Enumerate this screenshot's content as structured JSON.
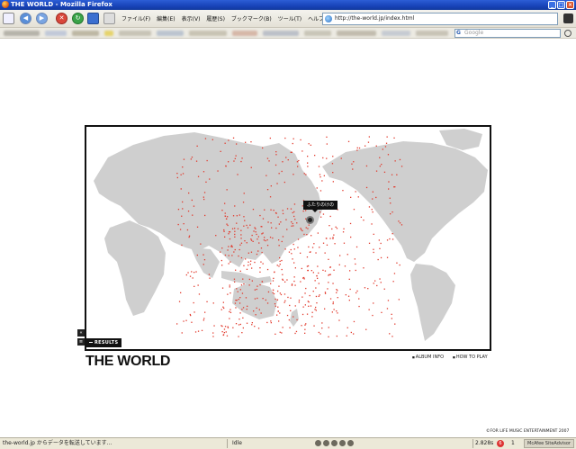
{
  "window": {
    "title": "THE WORLD - Mozilla Firefox"
  },
  "menu": {
    "items": [
      "ファイル(F)",
      "編集(E)",
      "表示(V)",
      "履歴(S)",
      "ブックマーク(B)",
      "ツール(T)",
      "ヘルプ(H)"
    ]
  },
  "toolbar": {
    "url": "http://the-world.jp/index.html",
    "search_placeholder": "Google",
    "search_engine_icon": "G"
  },
  "page": {
    "logo": "THE WORLD",
    "callout": "ふたりのけの",
    "results_label": "RESULTS",
    "album_info": "ALBUM INFO",
    "how_to_play": "HOW TO PLAY",
    "copyright": "©FOR LIFE MUSIC ENTERTAINMENT 2007",
    "side_ctrl_top": "«",
    "side_ctrl_bottom": "≡"
  },
  "status": {
    "text": "the-world.jp からデータを転送しています...",
    "idle": "Idle",
    "speed": "2.828s",
    "badge": "6",
    "count": "1",
    "security": "McAfee SiteAdvisor"
  },
  "colors": {
    "land": "#cfcfcf",
    "dots": "#e23b2e",
    "frame": "#111111"
  }
}
